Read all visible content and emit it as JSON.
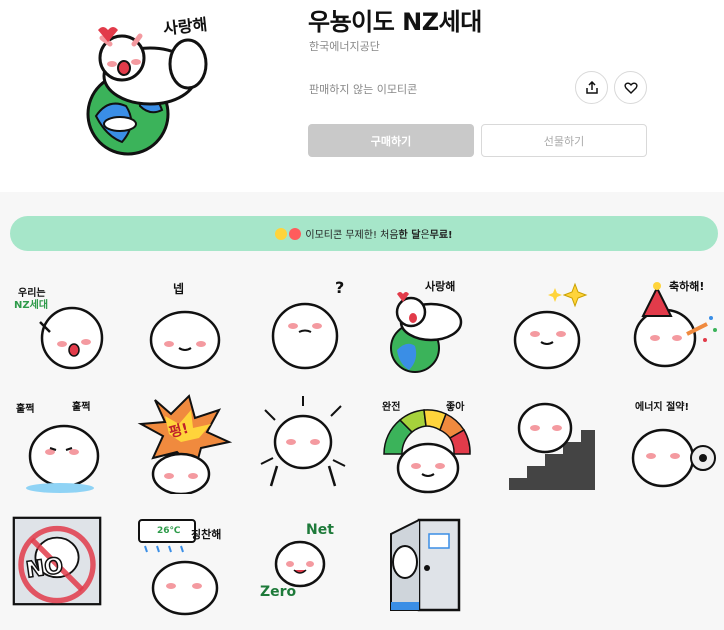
{
  "product": {
    "title": "우뇽이도 NZ세대",
    "author": "한국에너지공단",
    "note": "판매하지 않는 이모티콘",
    "hero_text": "사랑해"
  },
  "actions": {
    "buy_label": "구매하기",
    "gift_label": "선물하기",
    "share_icon": "share-icon",
    "like_icon": "heart-icon"
  },
  "banner": {
    "pre": "이모티콘 무제한! 처음 ",
    "bold1": "한 달",
    "mid": "은 ",
    "bold2": "무료!"
  },
  "emoticons": [
    {
      "text": "우리는",
      "text2": "NZ세대"
    },
    {
      "text": "넵"
    },
    {
      "text": "?"
    },
    {
      "text": "사랑해"
    },
    {
      "text": ""
    },
    {
      "text": "축하해!"
    },
    {
      "text": "훌쩍",
      "text2": "훌쩍"
    },
    {
      "text": "펑!"
    },
    {
      "text": ""
    },
    {
      "text": "완전",
      "text2": "좋아",
      "gauge": [
        "1",
        "2",
        "3",
        "4",
        "5"
      ]
    },
    {
      "text": ""
    },
    {
      "text": "에너지 절약!"
    },
    {
      "text": "NO"
    },
    {
      "text": "칭찬해",
      "text2": "26℃"
    },
    {
      "text": "Net",
      "text2": "Zero"
    },
    {
      "text": ""
    }
  ],
  "colors": {
    "banner_bg": "#a6e6c9",
    "buy_bg": "#c9c9c9",
    "green": "#2e9b4a",
    "blob": "#ffffff",
    "blush": "#f49aa0"
  }
}
